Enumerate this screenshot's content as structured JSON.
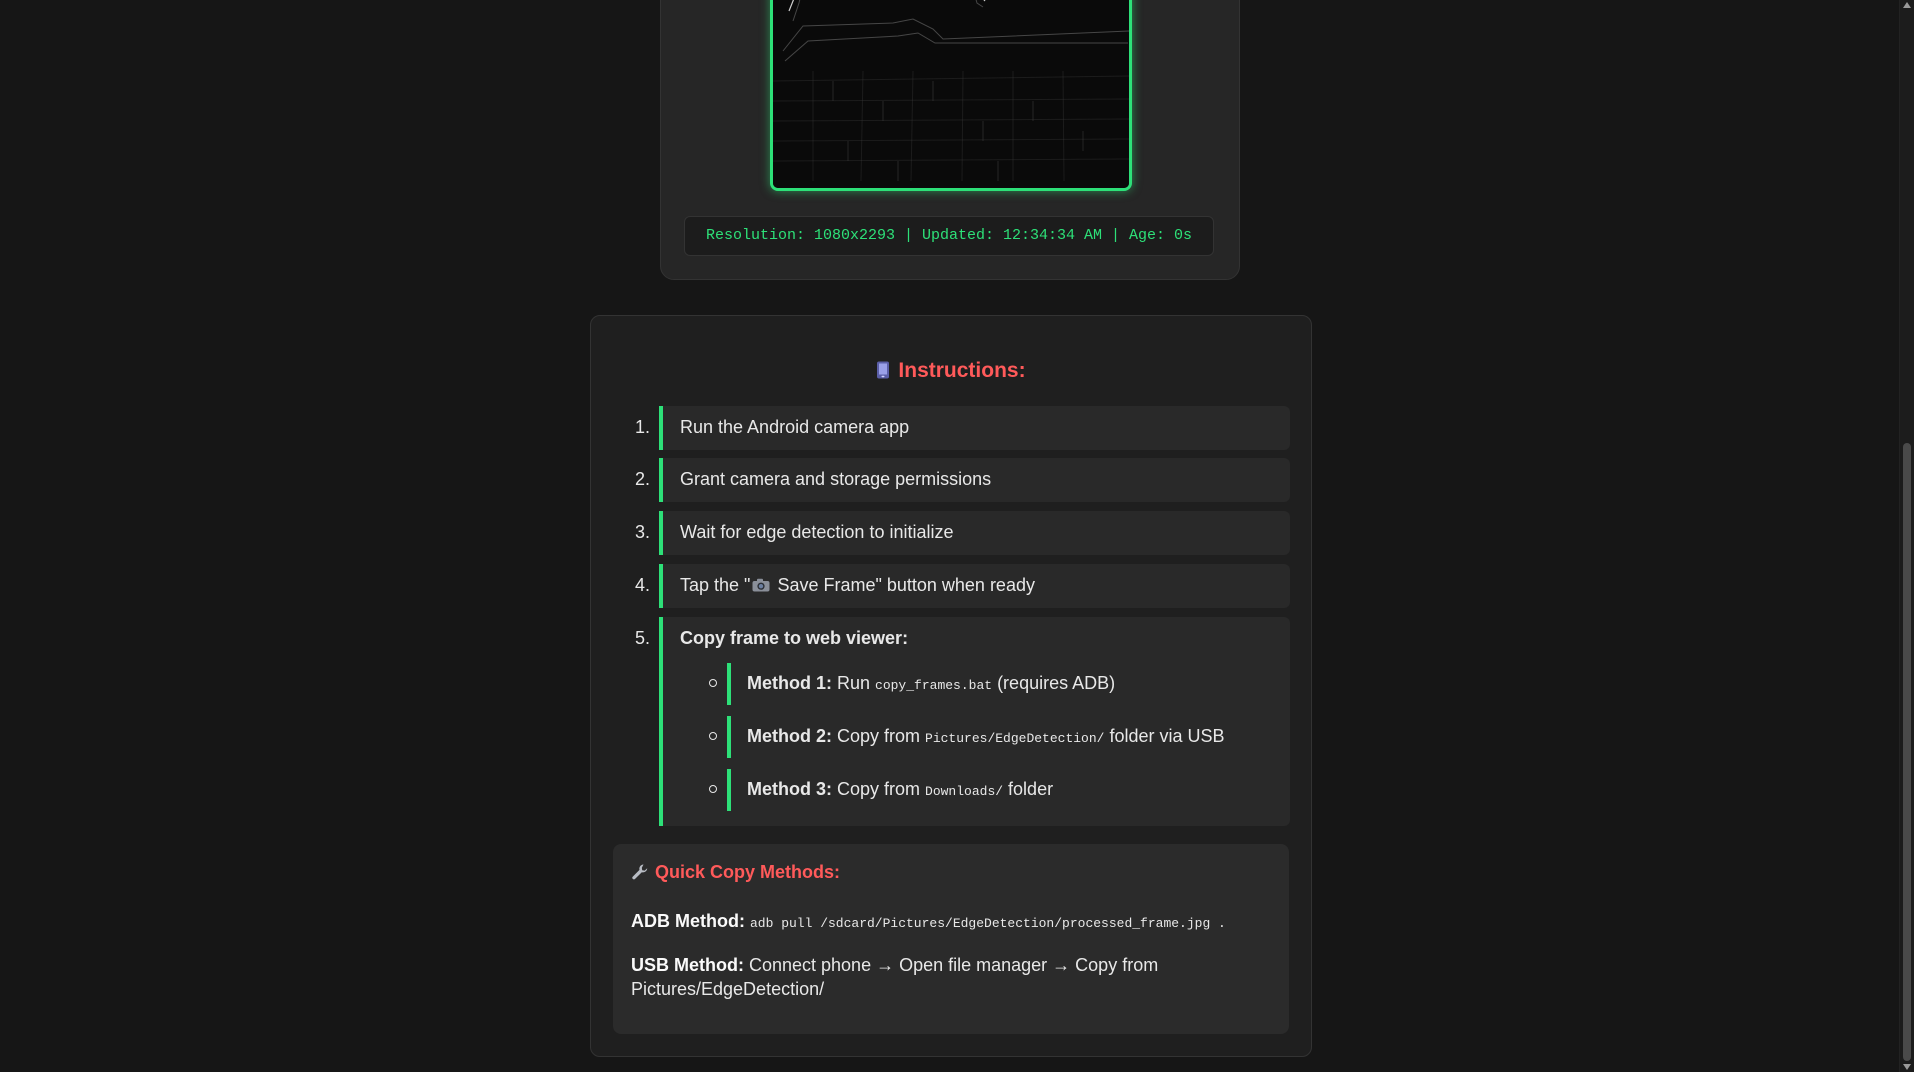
{
  "frame": {
    "info": "Resolution: 1080x2293 | Updated: 12:34:34 AM | Age: 0s"
  },
  "instructions": {
    "icon": "mobile-phone-icon",
    "title": "Instructions:",
    "steps": [
      {
        "num": "1.",
        "text": "Run the Android camera app"
      },
      {
        "num": "2.",
        "text": "Grant camera and storage permissions"
      },
      {
        "num": "3.",
        "text": "Wait for edge detection to initialize"
      },
      {
        "num": "4.",
        "text_before": "Tap the \"",
        "icon": "camera-icon",
        "text_after": " Save Frame\" button when ready"
      },
      {
        "num": "5.",
        "text": "Copy frame to web viewer:"
      }
    ],
    "methods": [
      {
        "label": "Method 1:",
        "before": " Run ",
        "code": "copy_frames.bat",
        "after": " (requires ADB)"
      },
      {
        "label": "Method 2:",
        "before": " Copy from ",
        "code": "Pictures/EdgeDetection/",
        "after": " folder via USB"
      },
      {
        "label": "Method 3:",
        "before": " Copy from ",
        "code": "Downloads/",
        "after": " folder"
      }
    ]
  },
  "quick_copy": {
    "icon": "wrench-icon",
    "title": "Quick Copy Methods:",
    "adb_label": "ADB Method:",
    "adb_command": "adb pull /sdcard/Pictures/EdgeDetection/processed_frame.jpg .",
    "usb_label": "USB Method:",
    "usb_text": "Connect phone → Open file manager → Copy from Pictures/EdgeDetection/"
  },
  "colors": {
    "accent_green": "#2de078",
    "heading_red": "#ff5a5a",
    "background": "#161616"
  }
}
